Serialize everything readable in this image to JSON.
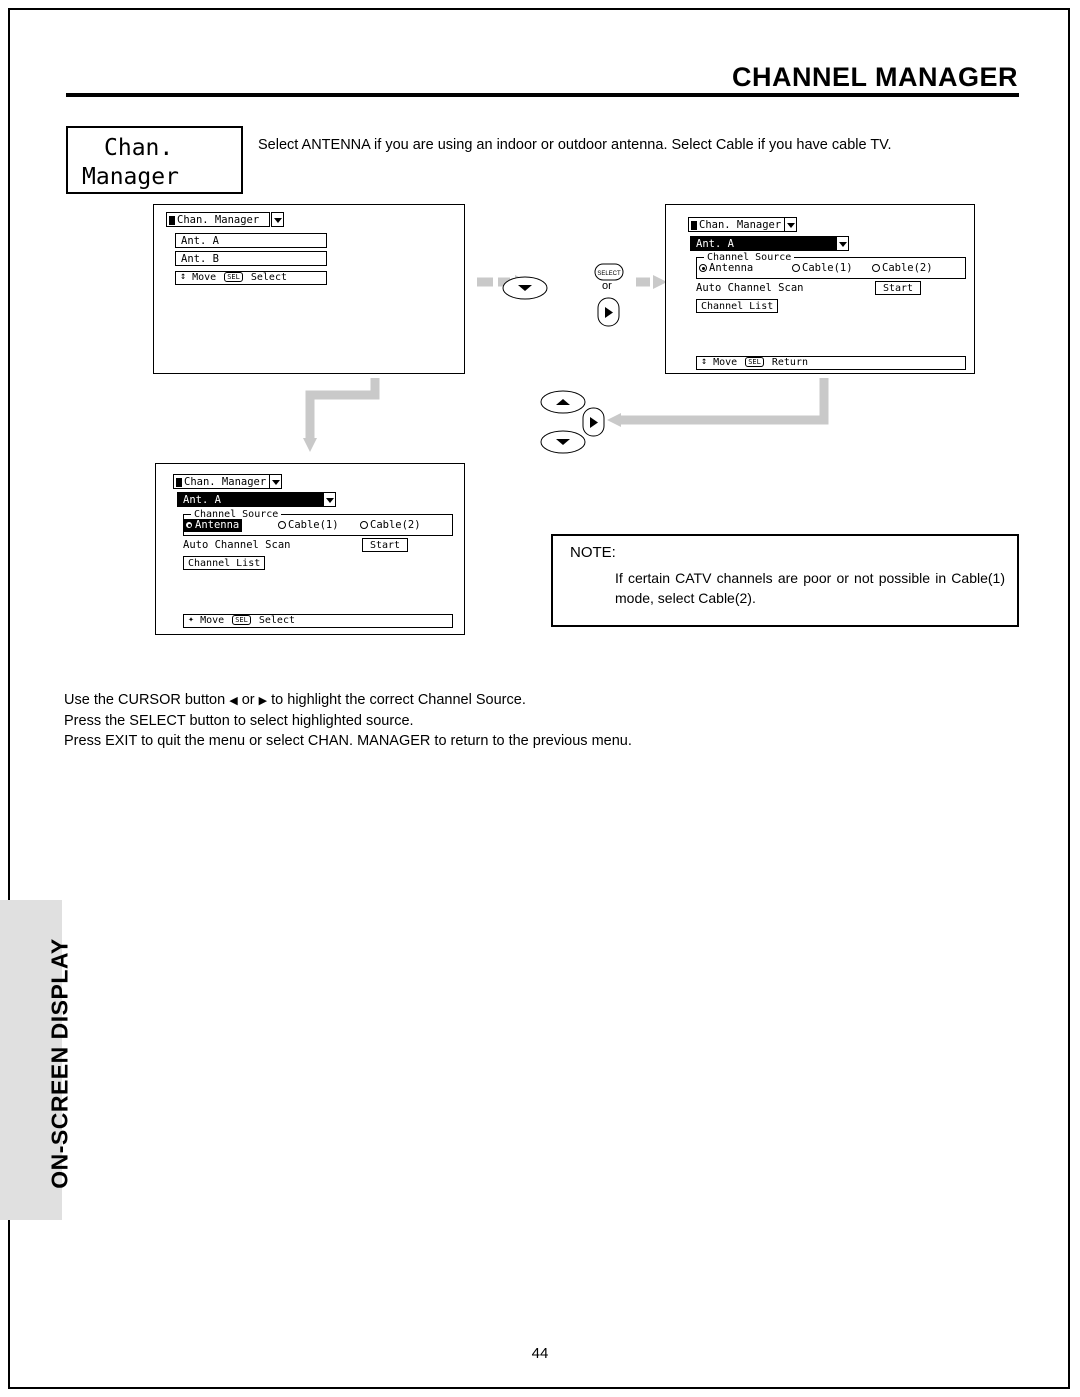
{
  "header": {
    "title": "CHANNEL MANAGER"
  },
  "menu_label": {
    "line1": "Chan.",
    "line2": "Manager"
  },
  "intro": "Select ANTENNA if you are using an indoor or outdoor antenna.  Select Cable if you have cable TV.",
  "osd1": {
    "title": "Chan. Manager",
    "items": [
      "Ant. A",
      "Ant. B"
    ],
    "footer_move": "Move",
    "footer_key": "SEL",
    "footer_action": "Select"
  },
  "osd2": {
    "title": "Chan. Manager",
    "selected_item": "Ant. A",
    "group_legend": "Channel Source",
    "options": [
      "Antenna",
      "Cable(1)",
      "Cable(2)"
    ],
    "scan_label": "Auto Channel Scan",
    "start_button": "Start",
    "channel_list_button": "Channel List",
    "footer_move": "Move",
    "footer_key": "SEL",
    "footer_action": "Return"
  },
  "osd3": {
    "title": "Chan. Manager",
    "selected_item": "Ant. A",
    "group_legend": "Channel Source",
    "options": [
      "Antenna",
      "Cable(1)",
      "Cable(2)"
    ],
    "scan_label": "Auto Channel Scan",
    "start_button": "Start",
    "channel_list_button": "Channel List",
    "footer_move": "Move",
    "footer_key": "SEL",
    "footer_action": "Select"
  },
  "remote": {
    "select_label": "SELECT",
    "or_label": "or"
  },
  "note": {
    "title": "NOTE:",
    "body": "If certain CATV channels are poor or not possible in Cable(1) mode, select Cable(2)."
  },
  "instructions": {
    "line1_a": "Use the CURSOR button ",
    "line1_left": "◀",
    "line1_b": " or ",
    "line1_right": "▶",
    "line1_c": " to highlight the correct Channel Source.",
    "line2": "Press the SELECT button to select highlighted source.",
    "line3": "Press EXIT to quit the menu or select CHAN. MANAGER to return to the previous menu."
  },
  "side_band_label": "ON-SCREEN DISPLAY",
  "page_number": "44"
}
